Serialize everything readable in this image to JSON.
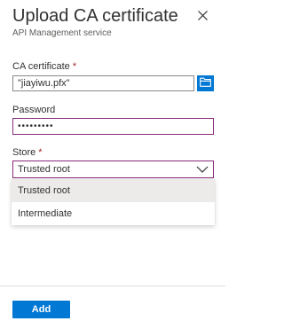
{
  "header": {
    "title": "Upload CA certificate",
    "subtitle": "API Management service",
    "close_icon": "close-icon"
  },
  "ca_certificate": {
    "label": "CA certificate",
    "required_mark": "*",
    "value": "\"jiayiwu.pfx\"",
    "browse_icon": "folder-icon"
  },
  "password": {
    "label": "Password",
    "value": "•••••••••"
  },
  "store": {
    "label": "Store",
    "required_mark": "*",
    "selected": "Trusted root",
    "options": [
      "Trusted root",
      "Intermediate"
    ],
    "chevron_icon": "chevron-down-icon"
  },
  "footer": {
    "add_label": "Add"
  },
  "colors": {
    "accent": "#0078d4",
    "focus_border": "#8a2a7a",
    "required": "#a4262c",
    "selected_option_bg": "#edebe9"
  }
}
